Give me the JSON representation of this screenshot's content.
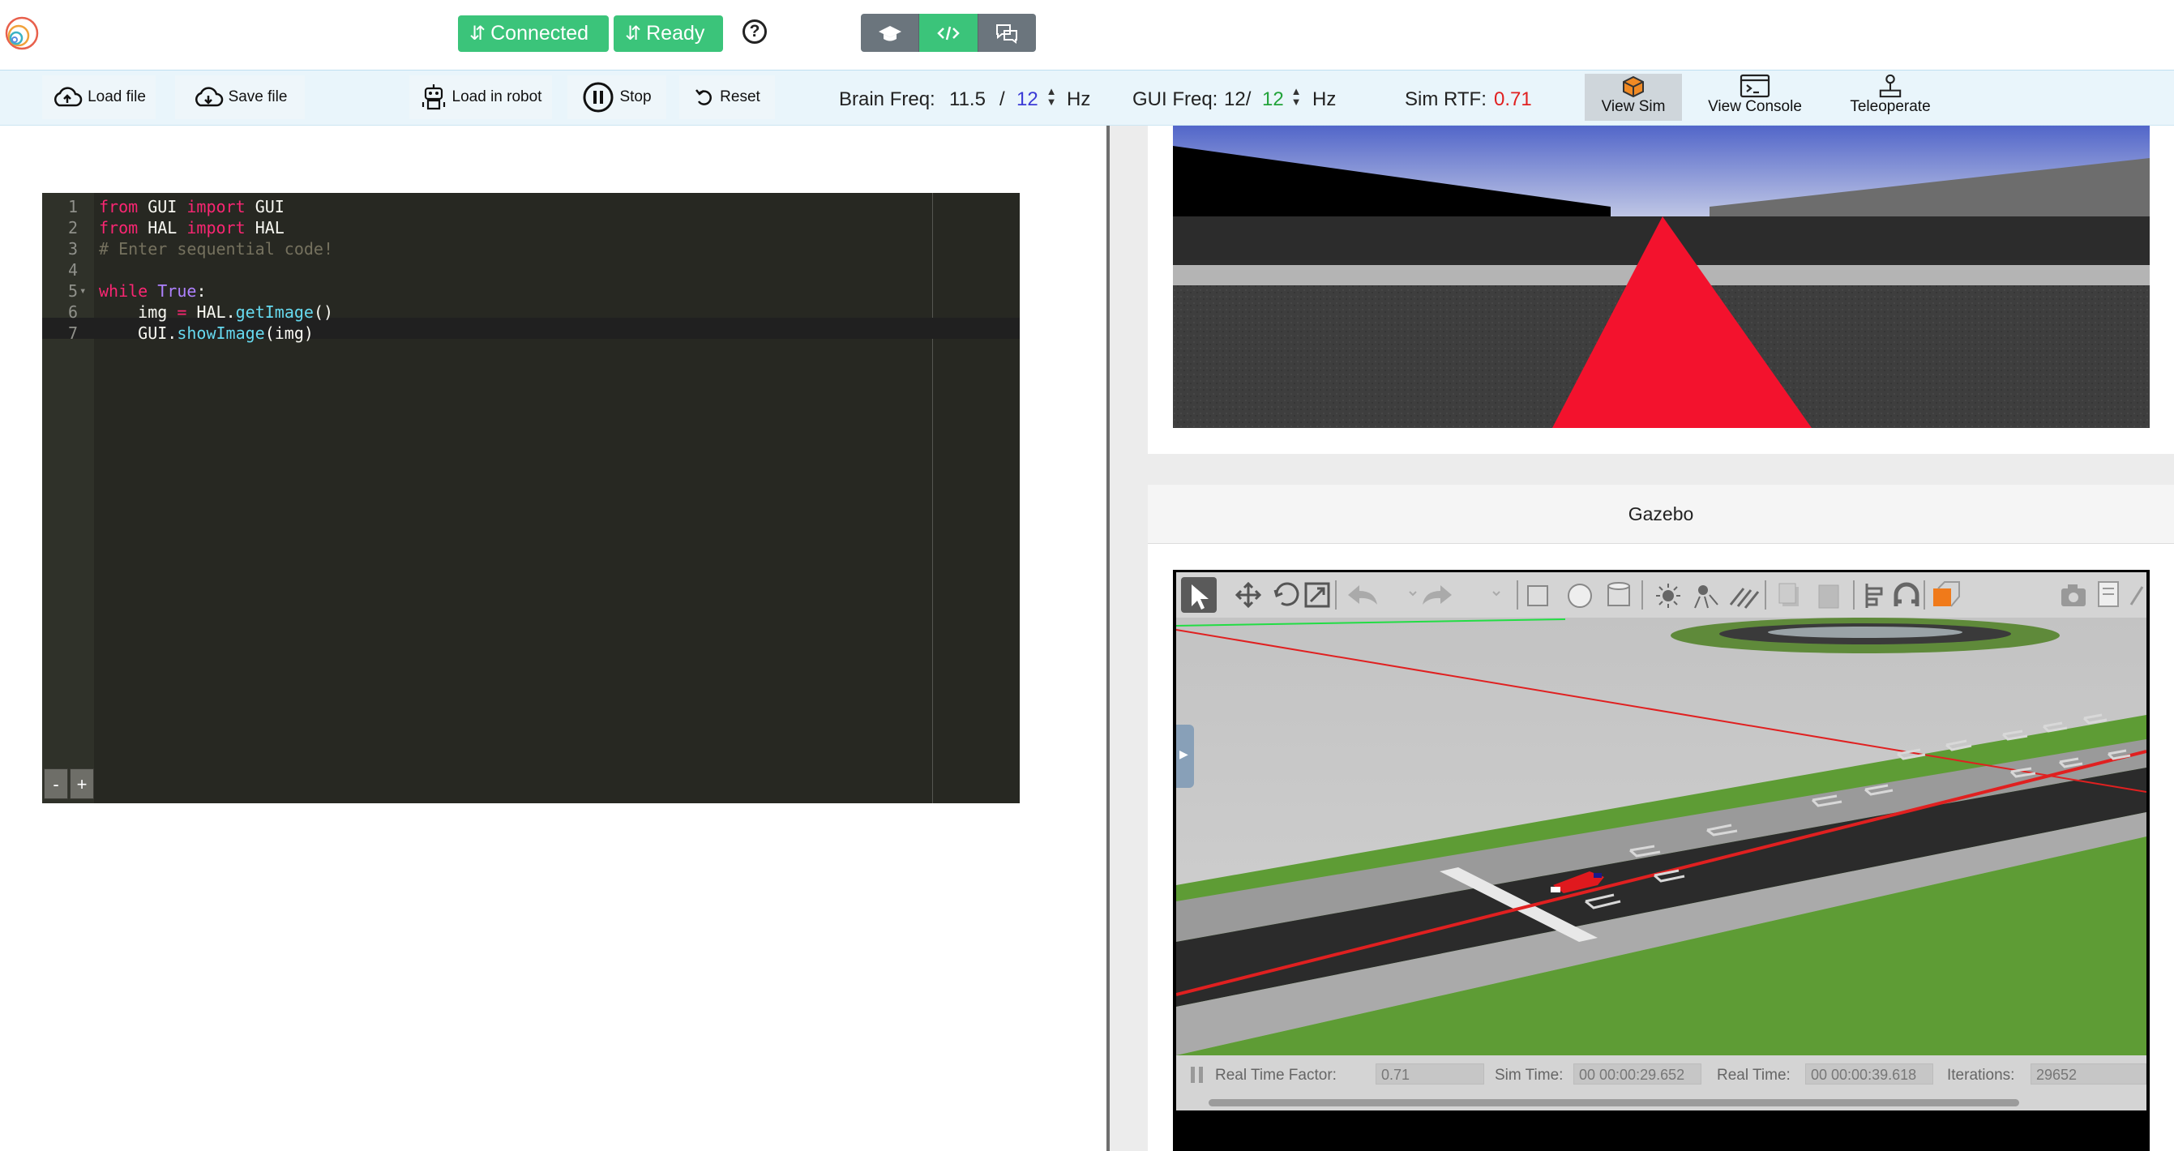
{
  "header": {
    "connected_label": "Connected",
    "ready_label": "Ready",
    "help_label": "?"
  },
  "toolbar": {
    "load_file": "Load file",
    "save_file": "Save file",
    "load_robot": "Load in robot",
    "stop": "Stop",
    "reset": "Reset",
    "brain_freq_label": "Brain Freq:",
    "brain_freq_value": "11.5",
    "brain_freq_sep": "/",
    "brain_freq_target": "12",
    "hz": "Hz",
    "gui_freq_label": "GUI Freq:",
    "gui_freq_value": "12/",
    "gui_freq_target": "12",
    "sim_rtf_label": "Sim RTF:",
    "sim_rtf_value": "0.71",
    "view_sim": "View Sim",
    "view_console": "View Console",
    "teleoperate": "Teleoperate"
  },
  "colors": {
    "brain_target": "#3b3bd6",
    "gui_target": "#22a33a",
    "rtf": "#e02020",
    "accent_green": "#3bc47a"
  },
  "editor": {
    "lines": [
      {
        "n": "1",
        "code": "from GUI import GUI"
      },
      {
        "n": "2",
        "code": "from HAL import HAL"
      },
      {
        "n": "3",
        "code": "# Enter sequential code!"
      },
      {
        "n": "4",
        "code": ""
      },
      {
        "n": "5",
        "code": "while True:"
      },
      {
        "n": "6",
        "code": "    img = HAL.getImage()"
      },
      {
        "n": "7",
        "code": "    GUI.showImage(img)"
      }
    ],
    "zoom_out": "-",
    "zoom_in": "+"
  },
  "gazebo": {
    "title": "Gazebo",
    "real_time_factor_label": "Real Time Factor:",
    "real_time_factor": "0.71",
    "sim_time_label": "Sim Time:",
    "sim_time": "00 00:00:29.652",
    "real_time_label": "Real Time:",
    "real_time": "00 00:00:39.618",
    "iterations_label": "Iterations:",
    "iterations": "29652"
  }
}
